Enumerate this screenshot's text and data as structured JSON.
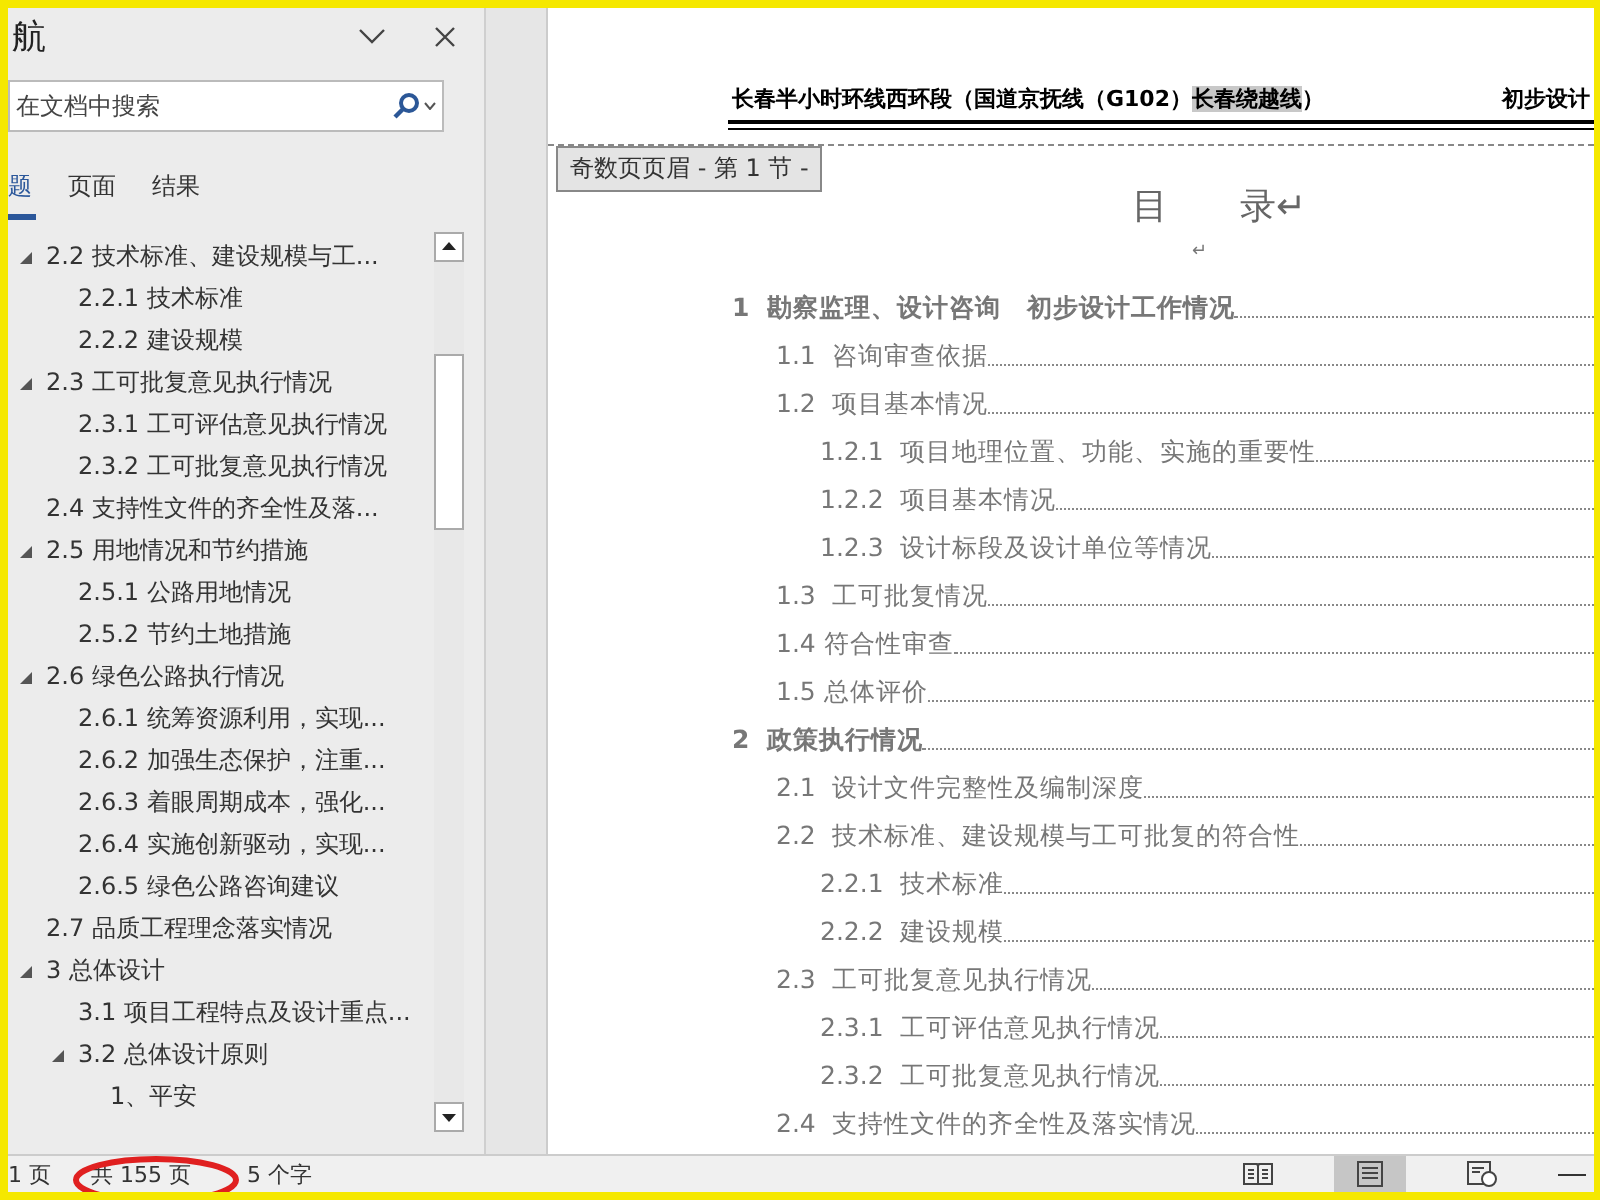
{
  "nav": {
    "title": "航",
    "search": {
      "placeholder": "在文档中搜索"
    },
    "tabs": [
      {
        "label": "题",
        "selected": true
      },
      {
        "label": "页面",
        "selected": false
      },
      {
        "label": "结果",
        "selected": false
      }
    ],
    "tree": [
      {
        "children": [
          {
            "label": "2.2 技术标准、建设规模与工...",
            "expanded": true,
            "children": [
              {
                "label": "2.2.1 技术标准"
              },
              {
                "label": "2.2.2 建设规模"
              }
            ]
          },
          {
            "label": "2.3 工可批复意见执行情况",
            "expanded": true,
            "children": [
              {
                "label": "2.3.1 工可评估意见执行情况"
              },
              {
                "label": "2.3.2 工可批复意见执行情况"
              }
            ]
          },
          {
            "label": "2.4 支持性文件的齐全性及落..."
          },
          {
            "label": "2.5 用地情况和节约措施",
            "expanded": true,
            "children": [
              {
                "label": "2.5.1 公路用地情况"
              },
              {
                "label": "2.5.2 节约土地措施"
              }
            ]
          },
          {
            "label": "2.6 绿色公路执行情况",
            "expanded": true,
            "children": [
              {
                "label": "2.6.1 统筹资源利用，实现..."
              },
              {
                "label": "2.6.2 加强生态保护，注重..."
              },
              {
                "label": "2.6.3 着眼周期成本，强化..."
              },
              {
                "label": "2.6.4 实施创新驱动，实现..."
              },
              {
                "label": "2.6.5 绿色公路咨询建议"
              }
            ]
          },
          {
            "label": "2.7 品质工程理念落实情况"
          }
        ]
      },
      {
        "label": "3 总体设计",
        "expanded": true,
        "children": [
          {
            "label": "3.1 项目工程特点及设计重点..."
          },
          {
            "label": "3.2 总体设计原则",
            "expanded": true,
            "children": [
              {
                "label": "1、平安"
              }
            ]
          }
        ]
      }
    ]
  },
  "document": {
    "header": [
      {
        "text": "长春半小时环线西环段（国道京抚线（G102）",
        "selected": false
      },
      {
        "text": "长春绕越线",
        "selected": true
      },
      {
        "text": "）",
        "selected": false
      }
    ],
    "header_right": "初步设计",
    "header_tag": "奇数页页眉 - 第 1 节 -",
    "title": "目　　录↵",
    "blank_mark": "↵",
    "toc": [
      {
        "label": "1  勘察监理、设计咨询   初步设计工作情况",
        "children": [
          {
            "label": "1.1  咨询审查依据"
          },
          {
            "label": "1.2  项目基本情况",
            "children": [
              {
                "label": "1.2.1  项目地理位置、功能、实施的重要性"
              },
              {
                "label": "1.2.2  项目基本情况"
              },
              {
                "label": "1.2.3  设计标段及设计单位等情况"
              }
            ]
          },
          {
            "label": "1.3  工可批复情况"
          },
          {
            "label": "1.4 符合性审查"
          },
          {
            "label": "1.5 总体评价"
          }
        ]
      },
      {
        "label": "2  政策执行情况",
        "children": [
          {
            "label": "2.1  设计文件完整性及编制深度"
          },
          {
            "label": "2.2  技术标准、建设规模与工可批复的符合性",
            "children": [
              {
                "label": "2.2.1  技术标准"
              },
              {
                "label": "2.2.2  建设规模"
              }
            ]
          },
          {
            "label": "2.3  工可批复意见执行情况",
            "children": [
              {
                "label": "2.3.1  工可评估意见执行情况"
              },
              {
                "label": "2.3.2  工可批复意见执行情况"
              }
            ]
          },
          {
            "label": "2.4  支持性文件的齐全性及落实情况"
          }
        ]
      }
    ]
  },
  "status_bar": {
    "items": [
      "1 页",
      "共 155 页",
      "5 个字"
    ],
    "views": [
      {
        "kind": "read",
        "selected": false
      },
      {
        "kind": "print",
        "selected": true
      },
      {
        "kind": "web",
        "selected": false
      }
    ]
  }
}
